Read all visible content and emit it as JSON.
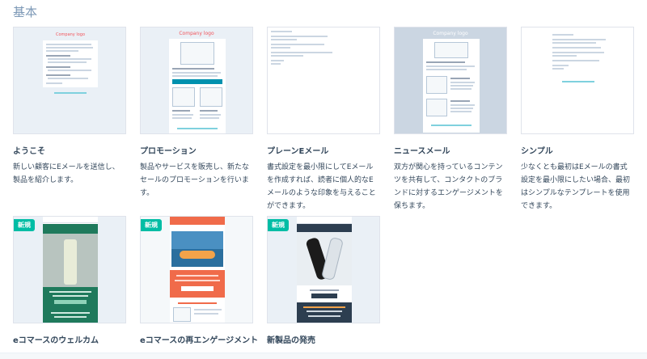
{
  "section": {
    "title": "基本"
  },
  "templates": [
    {
      "title": "ようこそ",
      "description": "新しい顧客にEメールを送信し、製品を紹介します。",
      "logo_text": "Company logo"
    },
    {
      "title": "プロモーション",
      "description": "製品やサービスを販売し、新たなセールのプロモーションを行います。",
      "logo_text": "Company logo"
    },
    {
      "title": "プレーンEメール",
      "description": "書式設定を最小限にしてEメールを作成すれば、読者に個人的なEメールのような印象を与えることができます。"
    },
    {
      "title": "ニュースメール",
      "description": "双方が関心を持っているコンテンツを共有して、コンタクトのブランドに対するエンゲージメントを保ちます。",
      "logo_text": "Company logo"
    },
    {
      "title": "シンプル",
      "description": "少なくとも最初はEメールの書式設定を最小限にしたい場合、最初はシンプルなテンプレートを使用できます。"
    },
    {
      "title": "eコマースのウェルカム",
      "badge": "新規"
    },
    {
      "title": "eコマースの再エンゲージメント",
      "badge": "新規"
    },
    {
      "title": "新製品の発売",
      "badge": "新規"
    }
  ],
  "colors": {
    "accent_teal": "#00bda5",
    "brand_coral": "#f2545b",
    "promo_teal": "#0091ae",
    "ecom_green": "#1f7a5c",
    "ecom_orange": "#f06b4a",
    "navy": "#2d3e50"
  }
}
